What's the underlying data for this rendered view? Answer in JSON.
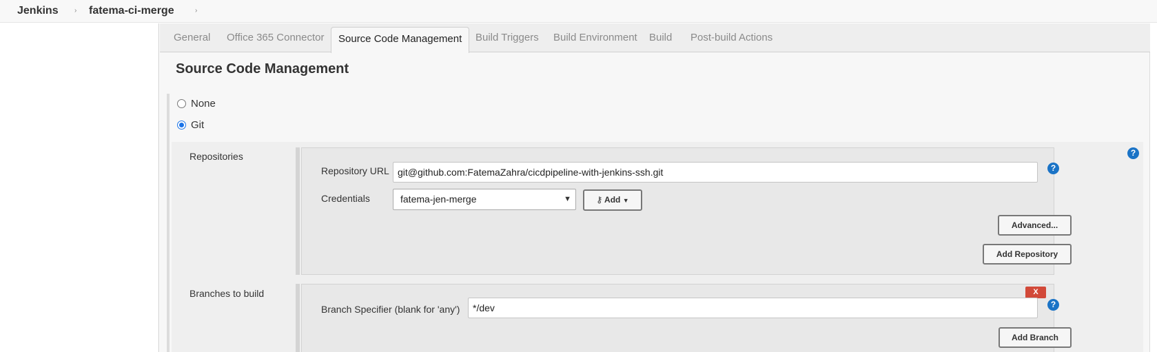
{
  "breadcrumb": {
    "items": [
      "Jenkins",
      "fatema-ci-merge"
    ],
    "separator": "›"
  },
  "tabs": [
    {
      "label": "General",
      "active": false
    },
    {
      "label": "Office 365 Connector",
      "active": false
    },
    {
      "label": "Source Code Management",
      "active": true
    },
    {
      "label": "Build Triggers",
      "active": false
    },
    {
      "label": "Build Environment",
      "active": false
    },
    {
      "label": "Build",
      "active": false
    },
    {
      "label": "Post-build Actions",
      "active": false
    }
  ],
  "section": {
    "title": "Source Code Management",
    "options": [
      {
        "label": "None",
        "selected": false
      },
      {
        "label": "Git",
        "selected": true
      }
    ]
  },
  "repositories": {
    "label": "Repositories",
    "url_label": "Repository URL",
    "url_value": "git@github.com:FatemaZahra/cicdpipeline-with-jenkins-ssh.git",
    "credentials_label": "Credentials",
    "credentials_value": "fatema-jen-merge",
    "add_label": "Add",
    "advanced_label": "Advanced...",
    "add_repo_label": "Add Repository",
    "help_icon": "question-icon"
  },
  "branches": {
    "label": "Branches to build",
    "specifier_label": "Branch Specifier (blank for 'any')",
    "specifier_value": "*/dev",
    "delete_label": "X",
    "add_branch_label": "Add Branch"
  },
  "colors": {
    "accent_blue": "#1a73c6",
    "delete_red": "#d24939"
  }
}
